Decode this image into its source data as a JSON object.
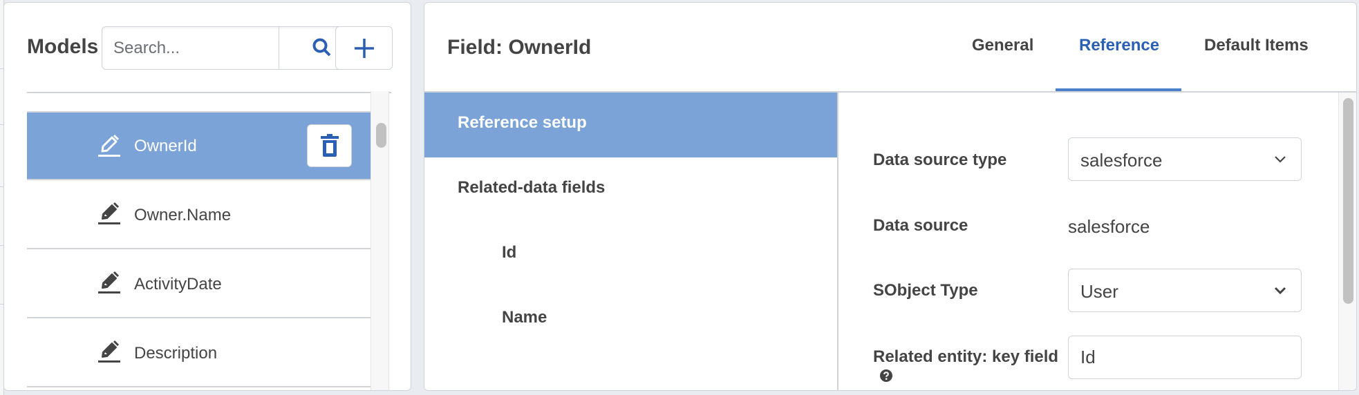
{
  "models_panel": {
    "title": "Models",
    "search": {
      "placeholder": "Search...",
      "value": ""
    },
    "search_icon": "search-icon",
    "add_icon": "plus-icon",
    "fields": [
      {
        "label": "OwnerId",
        "icon": "pencil-icon",
        "selected": true,
        "delete_icon": "trash-icon"
      },
      {
        "label": "Owner.Name",
        "icon": "pencil-icon",
        "selected": false
      },
      {
        "label": "ActivityDate",
        "icon": "pencil-icon",
        "selected": false
      },
      {
        "label": "Description",
        "icon": "pencil-icon",
        "selected": false
      }
    ]
  },
  "field_panel": {
    "title": "Field: OwnerId",
    "tabs": [
      {
        "label": "General",
        "active": false
      },
      {
        "label": "Reference",
        "active": true
      },
      {
        "label": "Default Items",
        "active": false
      }
    ],
    "side_menu": [
      {
        "label": "Reference setup",
        "active": true,
        "level": 1
      },
      {
        "label": "Related-data fields",
        "active": false,
        "level": 1
      },
      {
        "label": "Id",
        "active": false,
        "level": 2
      },
      {
        "label": "Name",
        "active": false,
        "level": 2
      }
    ],
    "form": {
      "data_source_type": {
        "label": "Data source type",
        "value": "salesforce"
      },
      "data_source": {
        "label": "Data source",
        "value": "salesforce"
      },
      "sobject_type": {
        "label": "SObject Type",
        "value": "User"
      },
      "key_field": {
        "label": "Related entity: key field",
        "value": "Id",
        "help_icon": "question-circle-icon"
      }
    }
  },
  "colors": {
    "accent": "#2b5fb4",
    "selected_bg": "#7ba3d7",
    "tab_underline": "#4a83c9",
    "border": "#d0d4d9",
    "text": "#444444",
    "page_bg": "#e9edf1"
  }
}
